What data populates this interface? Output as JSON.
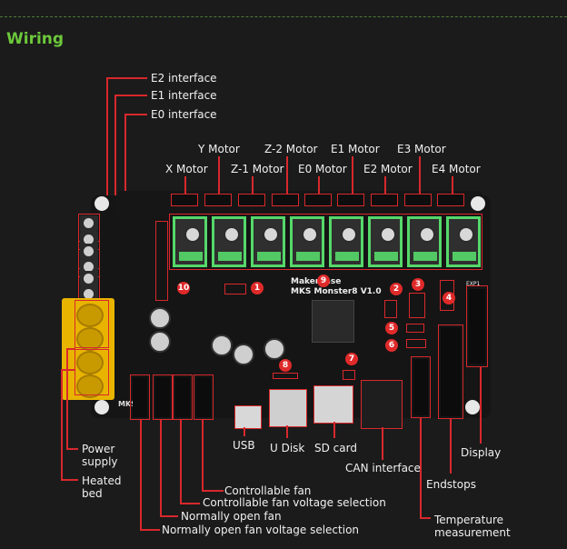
{
  "section": {
    "title": "Wiring"
  },
  "board": {
    "maker": "Makerbase",
    "model": "MKS Monster8 V1.0",
    "exp_label": "EXP1"
  },
  "accent_colors": {
    "title_green": "#6cc83b",
    "callout_red": "#d8282c",
    "driver_green": "#55d86a",
    "terminal_yellow": "#e8b400"
  },
  "top_labels": {
    "e2_interface": "E2 interface",
    "e1_interface": "E1 interface",
    "e0_interface": "E0 interface"
  },
  "motors": [
    {
      "label": "X Motor",
      "row": 2
    },
    {
      "label": "Y Motor",
      "row": 1
    },
    {
      "label": "Z-1 Motor",
      "row": 2
    },
    {
      "label": "Z-2 Motor",
      "row": 1
    },
    {
      "label": "E0 Motor",
      "row": 2
    },
    {
      "label": "E1 Motor",
      "row": 1
    },
    {
      "label": "E2 Motor",
      "row": 2
    },
    {
      "label": "E3 Motor",
      "row": 1
    },
    {
      "label": "E4 Motor",
      "row": 2
    }
  ],
  "badges": [
    "1",
    "2",
    "3",
    "4",
    "5",
    "6",
    "7",
    "8",
    "9",
    "10"
  ],
  "bottom_labels": {
    "power_supply": "Power supply",
    "heated_bed": "Heated bed",
    "usb": "USB",
    "u_disk": "U Disk",
    "sd_card": "SD card",
    "can_interface": "CAN interface",
    "endstops": "Endstops",
    "display": "Display",
    "temperature": "Temperature measurement",
    "controllable_fan": "Controllable fan",
    "controllable_fan_voltage": "Controllable fan voltage selection",
    "normally_open_fan": "Normally open fan",
    "normally_open_fan_voltage": "Normally open fan voltage selection"
  }
}
